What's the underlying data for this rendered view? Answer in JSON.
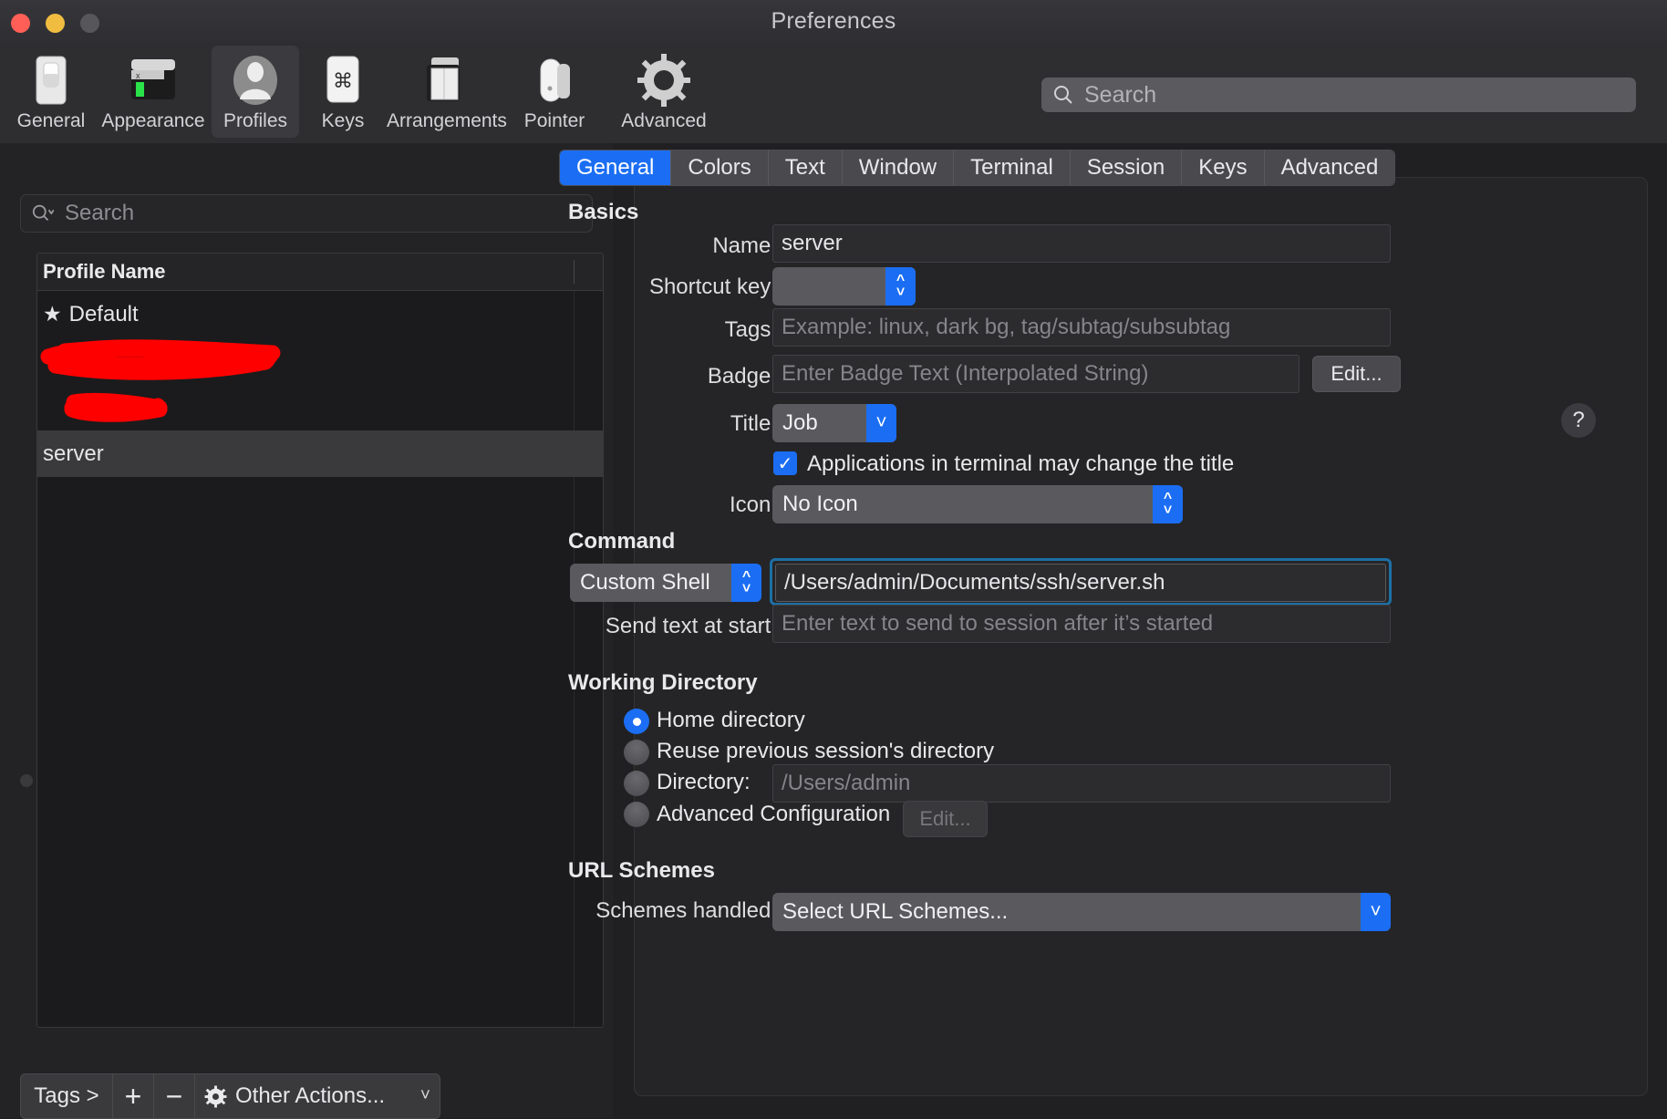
{
  "window": {
    "title": "Preferences"
  },
  "toolbar": {
    "items": [
      {
        "label": "General",
        "icon": "general-switch-icon"
      },
      {
        "label": "Appearance",
        "icon": "appearance-window-icon"
      },
      {
        "label": "Profiles",
        "icon": "profiles-person-icon"
      },
      {
        "label": "Keys",
        "icon": "keys-command-icon"
      },
      {
        "label": "Arrangements",
        "icon": "arrangements-windows-icon"
      },
      {
        "label": "Pointer",
        "icon": "pointer-mouse-icon"
      },
      {
        "label": "Advanced",
        "icon": "advanced-gear-icon"
      }
    ],
    "selected": "Profiles",
    "search_placeholder": "Search"
  },
  "sidebar": {
    "search_placeholder": "Search",
    "list": {
      "header": "Profile Name",
      "rows": [
        {
          "name": "Default",
          "starred": true,
          "redacted": false,
          "selected": false
        },
        {
          "name": "",
          "starred": false,
          "redacted": true,
          "selected": false
        },
        {
          "name": "",
          "starred": false,
          "redacted": true,
          "selected": false
        },
        {
          "name": "server",
          "starred": false,
          "redacted": false,
          "selected": true
        }
      ]
    },
    "bottom_bar": {
      "tags_label": "Tags >",
      "add_label": "+",
      "remove_label": "−",
      "other_actions_label": "Other Actions...",
      "chevron": "˅"
    }
  },
  "main": {
    "tabs": [
      {
        "label": "General",
        "active": true
      },
      {
        "label": "Colors",
        "active": false
      },
      {
        "label": "Text",
        "active": false
      },
      {
        "label": "Window",
        "active": false
      },
      {
        "label": "Terminal",
        "active": false
      },
      {
        "label": "Session",
        "active": false
      },
      {
        "label": "Keys",
        "active": false
      },
      {
        "label": "Advanced",
        "active": false
      }
    ],
    "basics": {
      "heading": "Basics",
      "name_label": "Name:",
      "name_value": "server",
      "shortcut_label": "Shortcut key:",
      "shortcut_value": "",
      "tags_label": "Tags:",
      "tags_placeholder": "Example: linux, dark bg, tag/subtag/subsubtag",
      "badge_label": "Badge:",
      "badge_placeholder": "Enter Badge Text (Interpolated String)",
      "badge_edit_button": "Edit...",
      "title_label": "Title:",
      "title_value": "Job",
      "title_help": "?",
      "apps_change_title_label": "Applications in terminal may change the title",
      "apps_change_title_checked": true,
      "icon_label": "Icon:",
      "icon_value": "No Icon"
    },
    "command": {
      "heading": "Command",
      "shell_value": "Custom Shell",
      "command_value": "/Users/admin/Documents/ssh/server.sh",
      "send_text_label": "Send text at start:",
      "send_text_placeholder": "Enter text to send to session after it’s started"
    },
    "working_directory": {
      "heading": "Working Directory",
      "options": [
        {
          "label": "Home directory",
          "selected": true
        },
        {
          "label": "Reuse previous session's directory",
          "selected": false
        },
        {
          "label": "Directory:",
          "selected": false
        },
        {
          "label": "Advanced Configuration",
          "selected": false
        }
      ],
      "directory_placeholder": "/Users/admin",
      "advanced_edit_button": "Edit..."
    },
    "url_schemes": {
      "heading": "URL Schemes",
      "schemes_label": "Schemes handled:",
      "schemes_value": "Select URL Schemes..."
    }
  },
  "colors": {
    "accent": "#1b6ef3",
    "window_bg": "#201f21",
    "panel_bg": "#252527",
    "redaction": "#ff0000"
  }
}
